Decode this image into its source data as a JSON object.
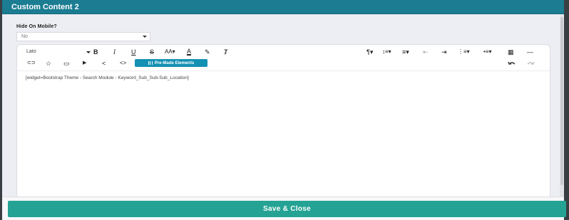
{
  "modal": {
    "title": "Custom Content 2"
  },
  "hide_on_mobile": {
    "label": "Hide On Mobile?",
    "value": "No"
  },
  "editor": {
    "font": "Lato",
    "toolbar_row1_left": [
      {
        "name": "bold-icon",
        "glyph": "B"
      },
      {
        "name": "italic-icon",
        "glyph": "I"
      },
      {
        "name": "underline-icon",
        "glyph": "U"
      },
      {
        "name": "strikethrough-icon",
        "glyph": "S"
      },
      {
        "name": "font-size-icon",
        "glyph": "AA▾"
      },
      {
        "name": "font-color-icon",
        "glyph": "A"
      },
      {
        "name": "highlight-icon",
        "glyph": "✎"
      },
      {
        "name": "clear-format-icon",
        "glyph": "Ⱦ"
      }
    ],
    "toolbar_row1_right": [
      {
        "name": "paragraph-format-icon",
        "glyph": "¶▾"
      },
      {
        "name": "line-height-icon",
        "glyph": "↕≡▾"
      },
      {
        "name": "align-icon",
        "glyph": "≡▾"
      },
      {
        "name": "outdent-icon",
        "glyph": "⇤"
      },
      {
        "name": "indent-icon",
        "glyph": "⇥"
      },
      {
        "name": "ordered-list-icon",
        "glyph": "⋮≡▾"
      },
      {
        "name": "unordered-list-icon",
        "glyph": "•≡▾"
      },
      {
        "name": "table-icon",
        "glyph": "▦"
      },
      {
        "name": "horizontal-line-icon",
        "glyph": "—"
      }
    ],
    "toolbar_row2": [
      {
        "name": "link-icon",
        "glyph": "⊂⊃"
      },
      {
        "name": "star-icon",
        "glyph": "☆"
      },
      {
        "name": "image-icon",
        "glyph": "▭"
      },
      {
        "name": "video-icon",
        "glyph": "▶"
      },
      {
        "name": "share-icon",
        "glyph": "<"
      },
      {
        "name": "code-view-icon",
        "glyph": "<>"
      }
    ],
    "premade_label": "Pre-Made Elements",
    "content": "[widget=Bootstrap Theme - Search Module - Keyword_Sub_Sub-Sub_Location]"
  },
  "footer": {
    "save_label": "Save & Close"
  }
}
